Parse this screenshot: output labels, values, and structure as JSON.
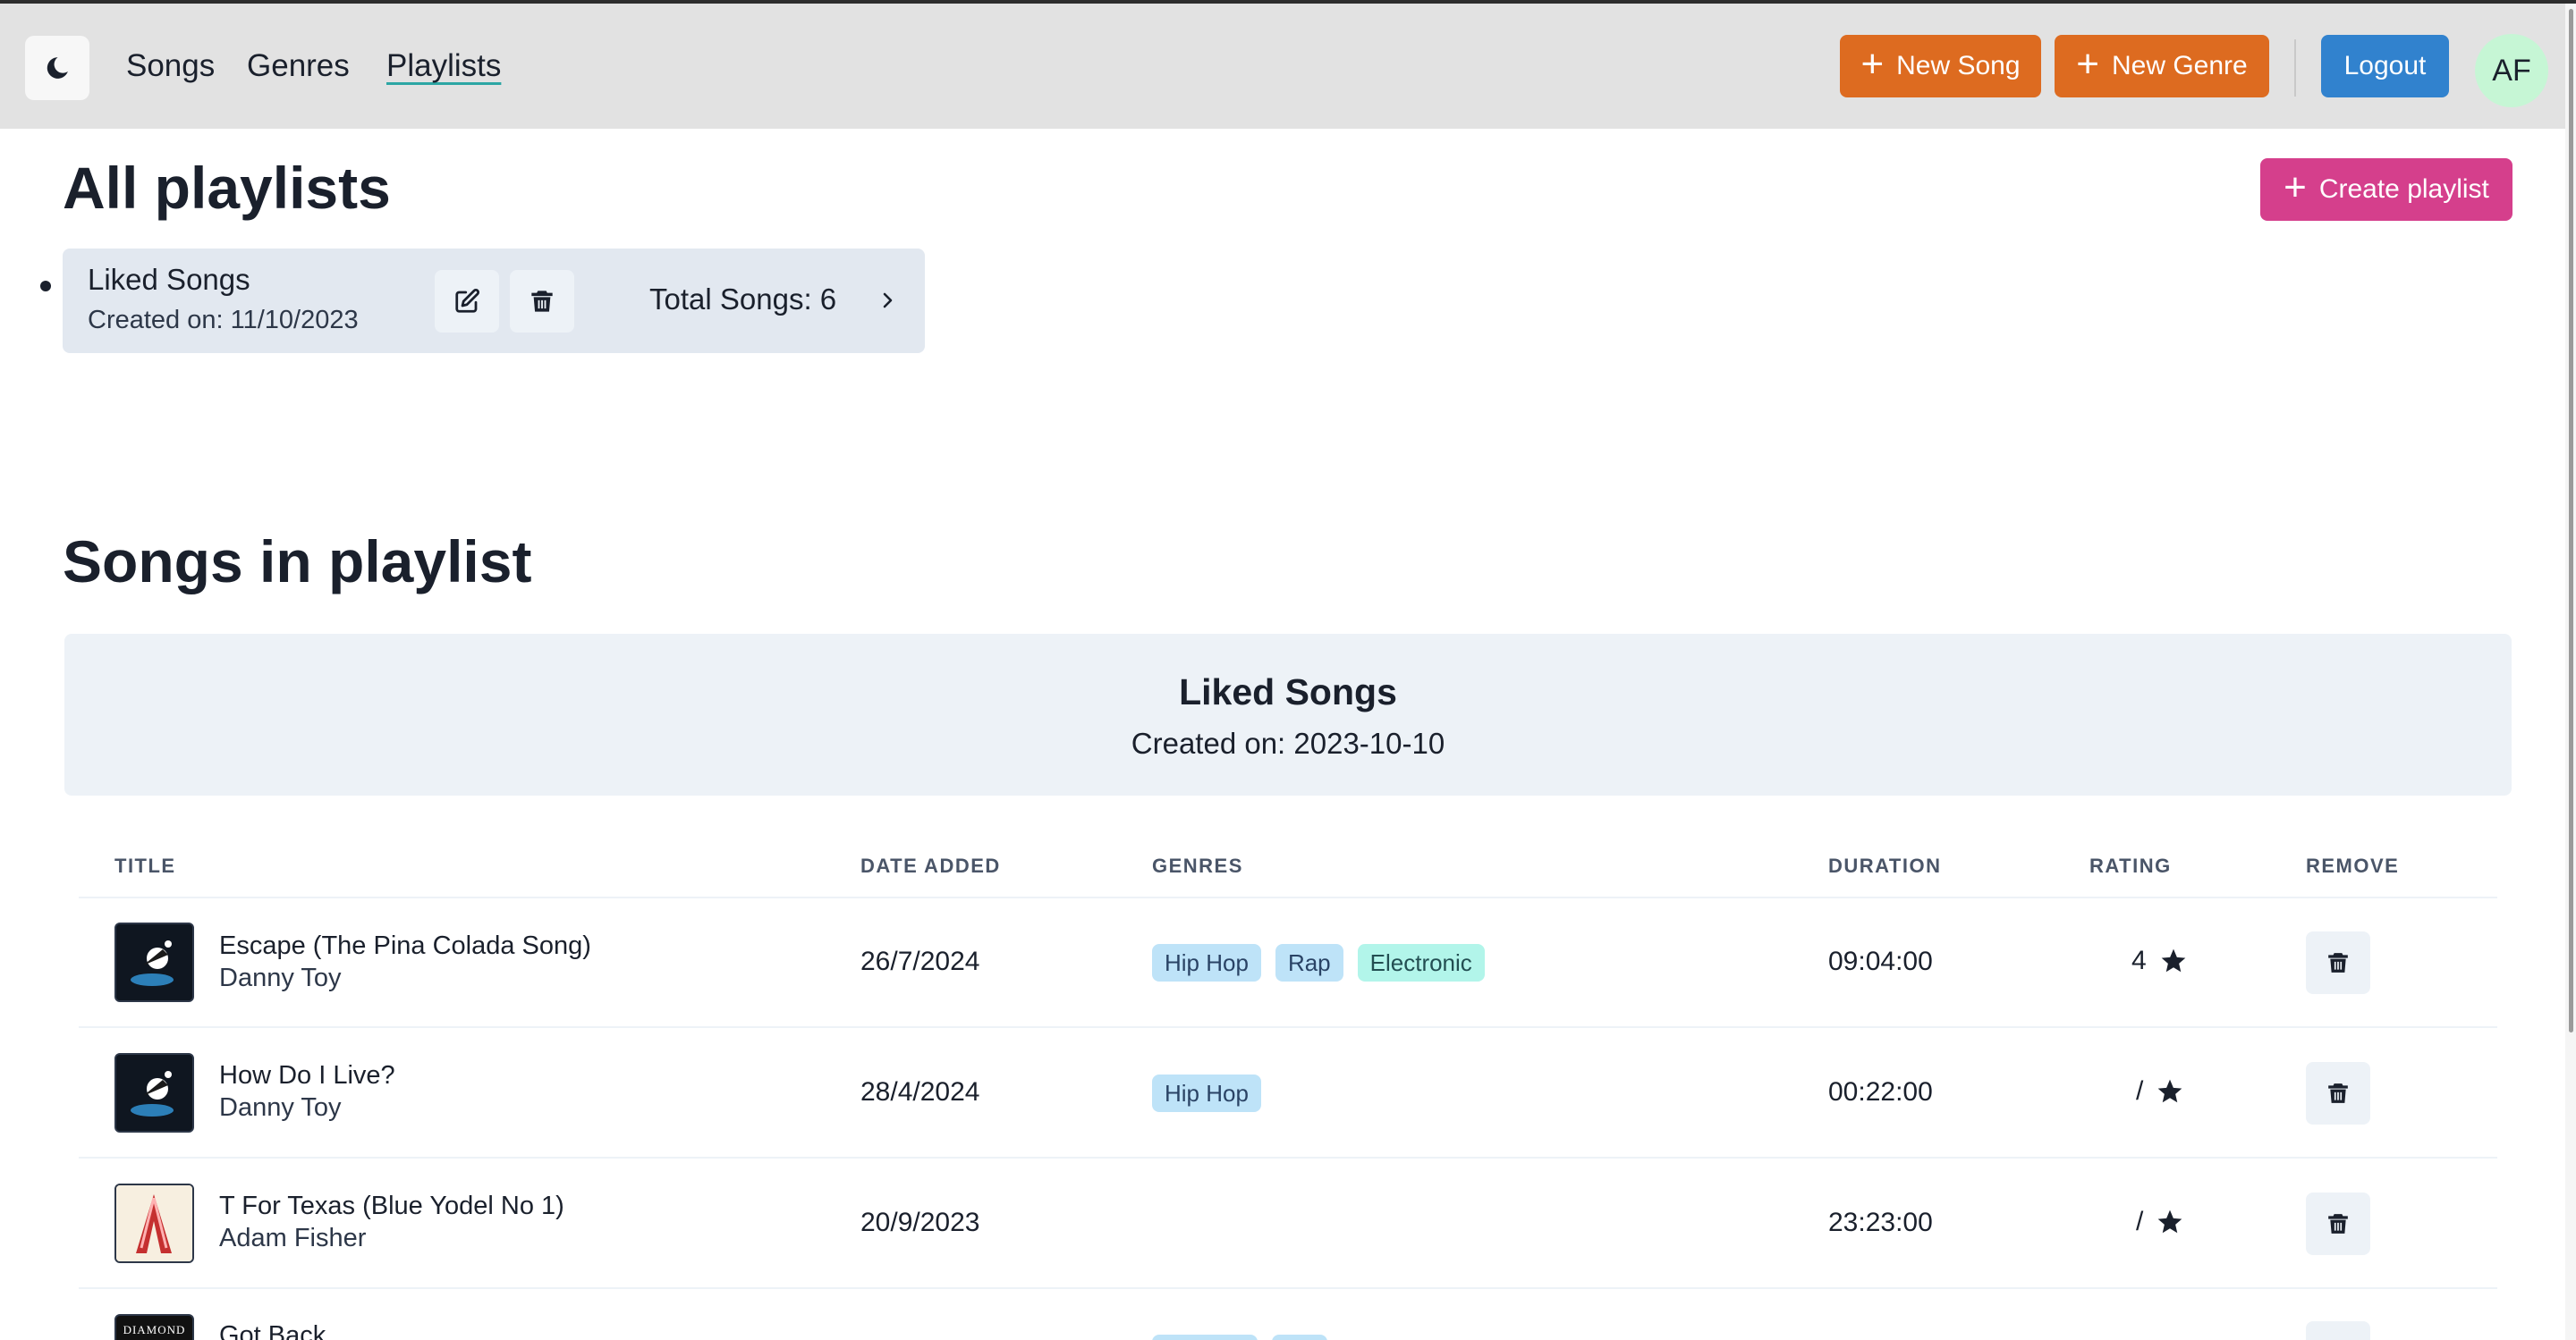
{
  "nav": {
    "links": [
      "Songs",
      "Genres",
      "Playlists"
    ],
    "active": "Playlists",
    "new_song_label": "New Song",
    "new_genre_label": "New Genre",
    "logout_label": "Logout",
    "avatar_initials": "AF",
    "theme_icon": "moon-icon"
  },
  "playlists_section": {
    "title": "All playlists",
    "create_label": "Create playlist",
    "items": [
      {
        "name": "Liked Songs",
        "created": "Created on: 11/10/2023",
        "total": "Total Songs: 6"
      }
    ]
  },
  "songs_section": {
    "title": "Songs in playlist",
    "playlist_name": "Liked Songs",
    "playlist_created": "Created on: 2023-10-10",
    "columns": [
      "TITLE",
      "DATE ADDED",
      "GENRES",
      "DURATION",
      "RATING",
      "REMOVE"
    ],
    "rows": [
      {
        "title": "Escape (The Pina Colada Song)",
        "artist": "Danny Toy",
        "date_added": "26/7/2024",
        "genres": [
          "Hip Hop",
          "Rap",
          "Electronic"
        ],
        "duration": "09:04:00",
        "rating": "4"
      },
      {
        "title": "How Do I Live?",
        "artist": "Danny Toy",
        "date_added": "28/4/2024",
        "genres": [
          "Hip Hop"
        ],
        "duration": "00:22:00",
        "rating": "/"
      },
      {
        "title": "T For Texas (Blue Yodel No 1)",
        "artist": "Adam Fisher",
        "date_added": "20/9/2023",
        "genres": [],
        "duration": "23:23:00",
        "rating": "/"
      },
      {
        "title": "Got Back",
        "cover_text": "DIAMOND"
      }
    ]
  },
  "colors": {
    "navbar_bg": "#e2e2e2",
    "orange": "#dd6b20",
    "blue": "#3182ce",
    "pink": "#d53f8c",
    "card_bg": "#e2e8f0",
    "tag_blue": "#bee3f8",
    "tag_teal": "#b2f5ea"
  }
}
